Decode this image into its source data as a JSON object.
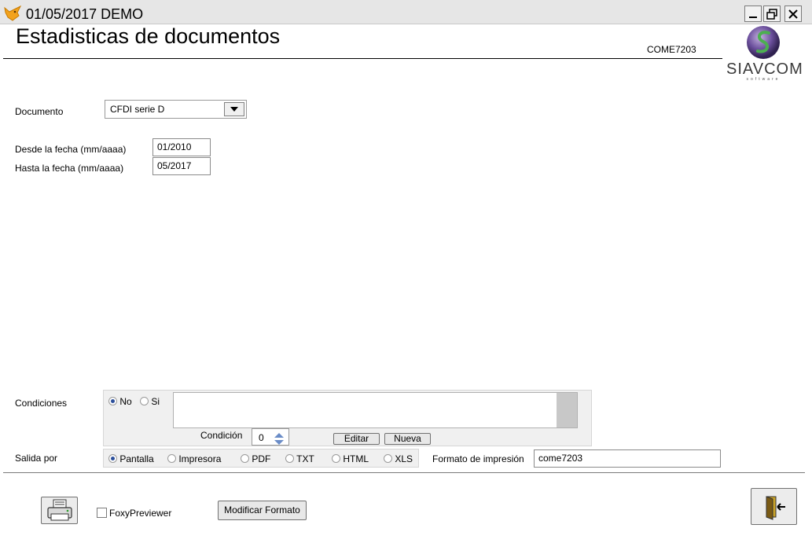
{
  "window": {
    "title": "01/05/2017  DEMO",
    "controls": [
      "minimize-icon",
      "restore-icon",
      "close-icon"
    ]
  },
  "header": {
    "heading": "Estadisticas de documentos",
    "form_code": "COME7203",
    "logo_text": "SIAVCOM",
    "logo_tagline": "software"
  },
  "form": {
    "documento_label": "Documento",
    "documento_value": "CFDI  serie D",
    "desde_label": "Desde la fecha (mm/aaaa)",
    "desde_value": "01/2010",
    "hasta_label": "Hasta la fecha (mm/aaaa)",
    "hasta_value": "05/2017"
  },
  "condiciones": {
    "label": "Condiciones",
    "options": [
      "No",
      "Si"
    ],
    "selected": "No",
    "text": "",
    "condicion_label": "Condición",
    "condicion_value": "0",
    "editar_label": "Editar",
    "nueva_label": "Nueva"
  },
  "salida": {
    "label": "Salida por",
    "options": [
      "Pantalla",
      "Impresora",
      "PDF",
      "TXT",
      "HTML",
      "XLS"
    ],
    "selected": "Pantalla",
    "formato_label": "Formato de impresión",
    "formato_value": "come7203"
  },
  "footer": {
    "foxy_label": "FoxyPreviewer",
    "foxy_checked": false,
    "modificar_label": "Modificar Formato",
    "icons": [
      "printer-icon",
      "exit-door-icon"
    ]
  },
  "colors": {
    "titlebar": "#e6e6e6",
    "panel": "#f0f0f0",
    "accent": "#2b4e9a"
  }
}
